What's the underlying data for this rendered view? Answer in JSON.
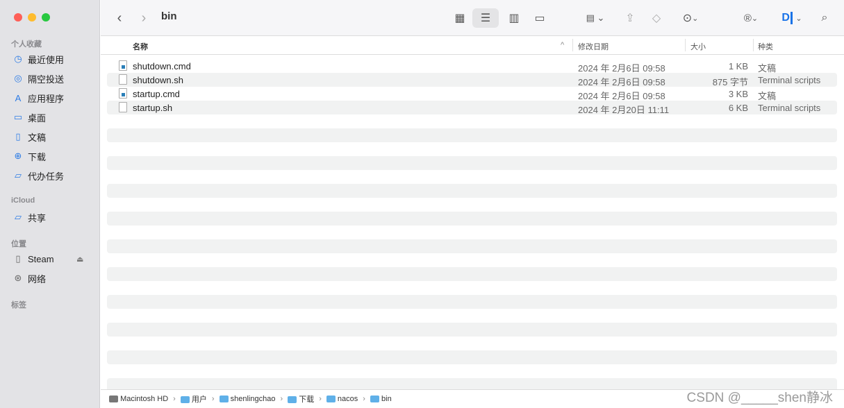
{
  "window": {
    "title": "bin"
  },
  "sidebar": {
    "sections": [
      {
        "label": "个人收藏",
        "items": [
          {
            "label": "最近使用",
            "icon": "clock-icon"
          },
          {
            "label": "隔空投送",
            "icon": "airdrop-icon"
          },
          {
            "label": "应用程序",
            "icon": "applications-icon"
          },
          {
            "label": "桌面",
            "icon": "desktop-icon"
          },
          {
            "label": "文稿",
            "icon": "document-icon"
          },
          {
            "label": "下载",
            "icon": "download-icon"
          },
          {
            "label": "代办任务",
            "icon": "folder-icon"
          }
        ]
      },
      {
        "label": "iCloud",
        "items": [
          {
            "label": "共享",
            "icon": "shared-folder-icon"
          }
        ]
      },
      {
        "label": "位置",
        "items": [
          {
            "label": "Steam",
            "icon": "disk-icon"
          },
          {
            "label": "网络",
            "icon": "network-icon"
          }
        ]
      },
      {
        "label": "标签",
        "items": []
      }
    ]
  },
  "columns": {
    "name": "名称",
    "date": "修改日期",
    "size": "大小",
    "kind": "种类"
  },
  "files": [
    {
      "name": "shutdown.cmd",
      "date": "2024 年 2月6日 09:58",
      "size": "1 KB",
      "kind": "文稿",
      "type": "cmd"
    },
    {
      "name": "shutdown.sh",
      "date": "2024 年 2月6日 09:58",
      "size": "875 字节",
      "kind": "Terminal scripts",
      "type": "sh"
    },
    {
      "name": "startup.cmd",
      "date": "2024 年 2月6日 09:58",
      "size": "3 KB",
      "kind": "文稿",
      "type": "cmd"
    },
    {
      "name": "startup.sh",
      "date": "2024 年 2月20日 11:11",
      "size": "6 KB",
      "kind": "Terminal scripts",
      "type": "sh"
    }
  ],
  "path": [
    "Macintosh HD",
    "用户",
    "shenlingchao",
    "下载",
    "nacos",
    "bin"
  ],
  "watermark": "CSDN @_____shen静冰",
  "colors": {
    "accent": "#2c7be5",
    "close": "#fe5f57",
    "minimize": "#febc2e",
    "zoom": "#28c840"
  }
}
